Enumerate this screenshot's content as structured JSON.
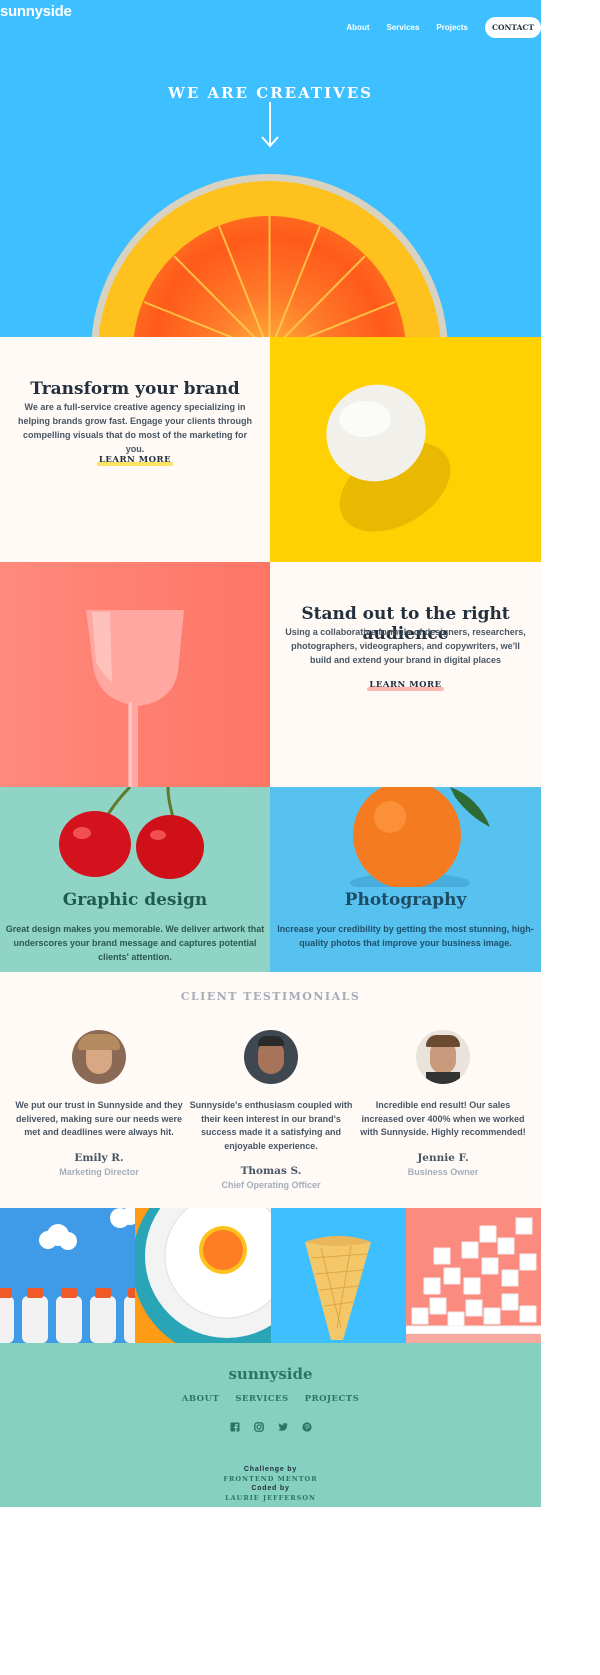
{
  "header": {
    "logo": "sunnyside",
    "nav": [
      "About",
      "Services",
      "Projects"
    ],
    "contact_label": "CONTACT"
  },
  "hero": {
    "title": "WE ARE CREATIVES",
    "arrow_icon": "arrow-down-icon"
  },
  "features": [
    {
      "title": "Transform your brand",
      "text": "We are a full-service creative agency specializing in helping brands grow fast. Engage your clients through compelling visuals that do most of the marketing for you.",
      "link": "LEARN MORE",
      "underline_color": "#fad400"
    },
    {
      "title": "Stand out to the right audience",
      "text": "Using a collaborative formula of designers, researchers, photographers, videographers, and copywriters, we'll build and extend your brand in digital places",
      "link": "LEARN MORE",
      "underline_color": "#fe7566"
    }
  ],
  "services": [
    {
      "title": "Graphic design",
      "text": "Great design makes you memorable. We deliver artwork that underscores your brand message and captures potential clients' attention.",
      "title_color": "#1f5b4e",
      "text_color": "#2c5a4f"
    },
    {
      "title": "Photography",
      "text": "Increase your credibility by getting the most stunning, high-quality photos that improve your business image.",
      "title_color": "#1e4c65",
      "text_color": "#1f506b"
    }
  ],
  "testimonials": {
    "heading": "CLIENT TESTIMONIALS",
    "items": [
      {
        "quote": "We put our trust in Sunnyside and they delivered, making sure our needs were met and deadlines were always hit.",
        "name": "Emily R.",
        "role": "Marketing Director"
      },
      {
        "quote": "Sunnyside's enthusiasm coupled with their keen interest in our brand's success made it a satisfying and enjoyable experience.",
        "name": "Thomas S.",
        "role": "Chief Operating Officer"
      },
      {
        "quote": "Incredible end result! Our sales increased over 400% when we worked with Sunnyside. Highly recommended!",
        "name": "Jennie F.",
        "role": "Business Owner"
      }
    ]
  },
  "footer": {
    "logo": "sunnyside",
    "links": [
      "ABOUT",
      "SERVICES",
      "PROJECTS"
    ],
    "social_icons": [
      "facebook-icon",
      "instagram-icon",
      "twitter-icon",
      "pinterest-icon"
    ],
    "attribution": {
      "challenge_by": "Challenge by",
      "challenge_name": "FRONTEND MENTOR",
      "coded_by": "Coded by",
      "coder_name": "LAURIE JEFFERSON"
    }
  },
  "colors": {
    "hero_blue": "#3ebfff",
    "cream": "#fffaf6",
    "yellow": "#ffd103",
    "coral": "#fe7565",
    "mint": "#90d4c5",
    "sky": "#57c2ef",
    "footer_mint": "#86d0bf",
    "dark_text": "#23303e"
  }
}
